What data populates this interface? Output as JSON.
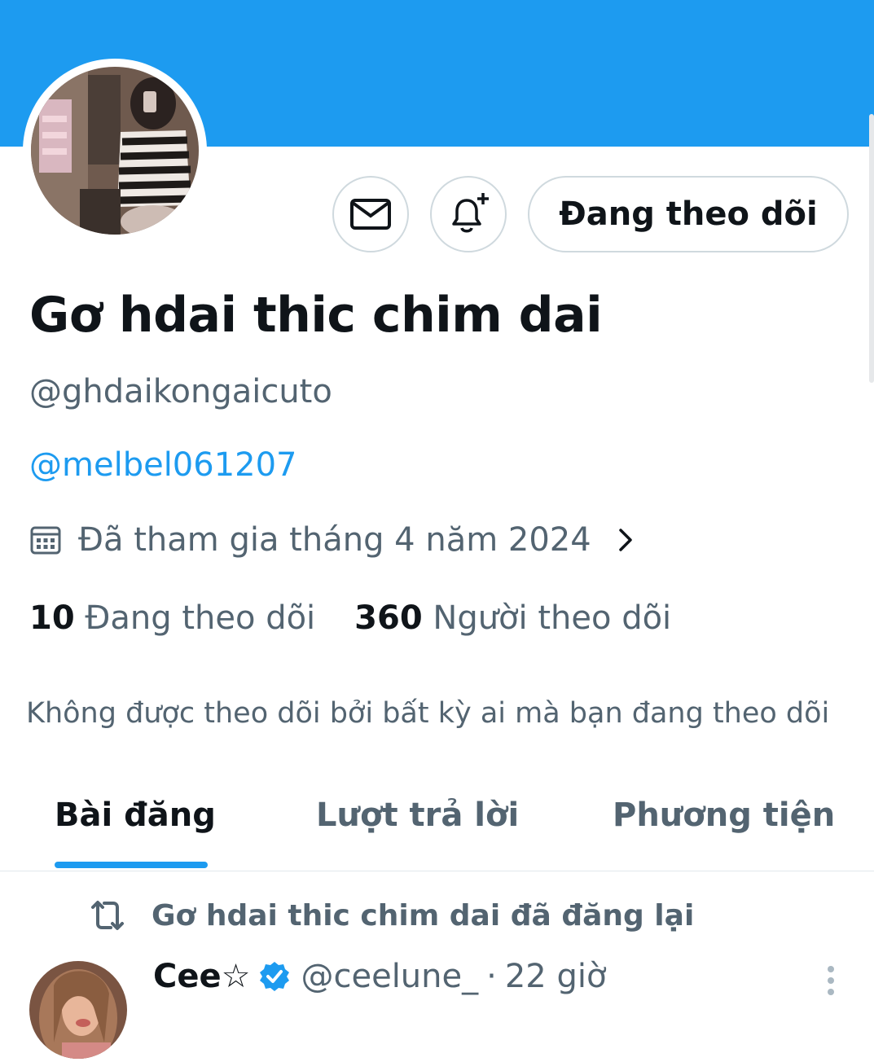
{
  "profile": {
    "display_name": "Gơ hdai thic chim dai",
    "handle": "@ghdaikongaicuto",
    "bio_link": "@melbel061207",
    "joined": "Đã tham gia tháng 4 năm 2024",
    "following_count": "10",
    "following_label": "Đang theo dõi",
    "followers_count": "360",
    "followers_label": "Người theo dõi",
    "followed_by": "Không được theo dõi bởi bất kỳ ai mà bạn đang theo dõi"
  },
  "actions": {
    "follow_label": "Đang theo dõi",
    "message_icon": "envelope-icon",
    "notify_icon": "bell-plus-icon"
  },
  "tabs": [
    {
      "label": "Bài đăng",
      "active": true
    },
    {
      "label": "Lượt trả lời",
      "active": false
    },
    {
      "label": "Phương tiện",
      "active": false
    }
  ],
  "tweet": {
    "repost_label": "Gơ hdai thic chim dai đã đăng lại",
    "author_name": "Cee☆",
    "author_handle": "@ceelune_",
    "separator": "·",
    "time": "22 giờ"
  },
  "colors": {
    "accent": "#1d9bf0",
    "text": "#0f1419",
    "secondary": "#536471",
    "border": "#cfd9de"
  }
}
